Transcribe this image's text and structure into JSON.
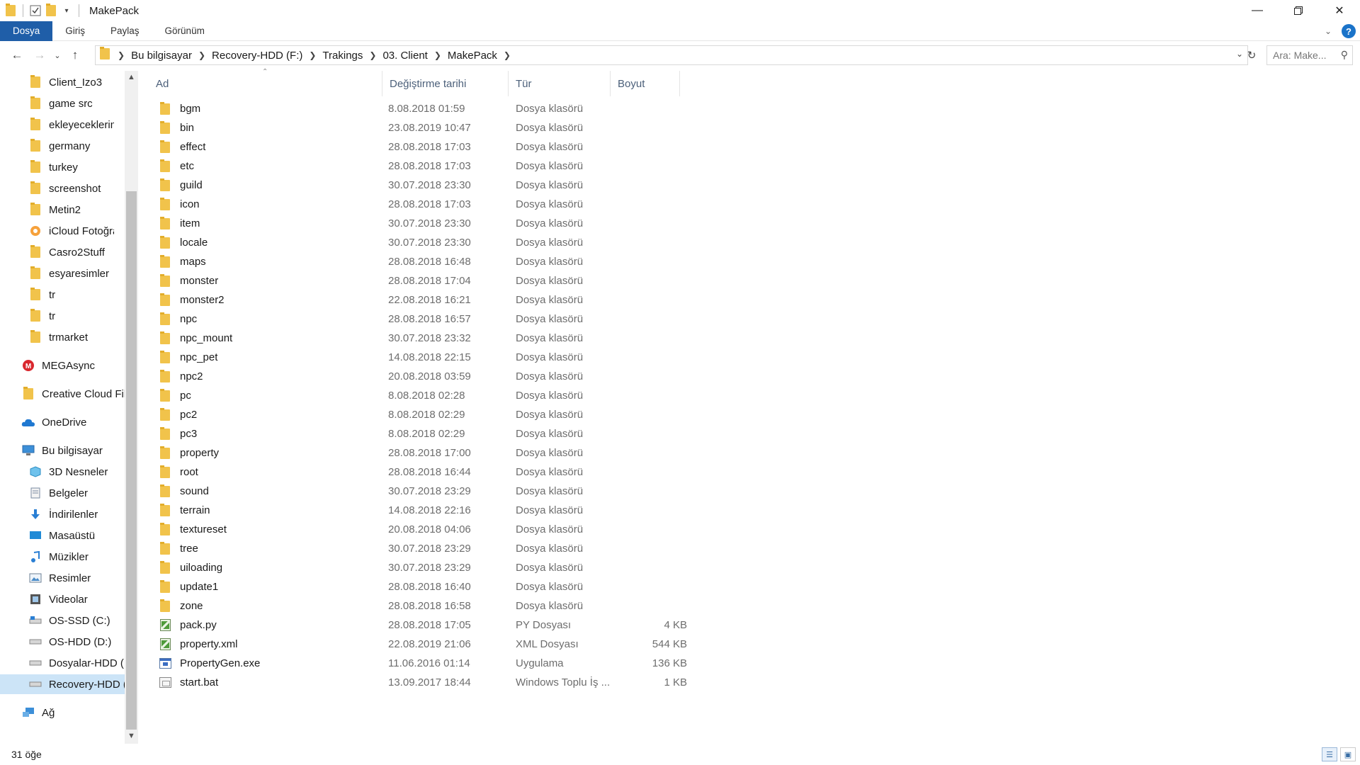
{
  "window": {
    "title": "MakePack"
  },
  "ribbon": {
    "tabs": [
      "Dosya",
      "Giriş",
      "Paylaş",
      "Görünüm"
    ]
  },
  "address": {
    "crumbs": [
      "Bu bilgisayar",
      "Recovery-HDD (F:)",
      "Trakings",
      "03. Client",
      "MakePack"
    ],
    "search_placeholder": "Ara: Make..."
  },
  "nav": {
    "quick_access": [
      {
        "label": "Client_Izo3",
        "pinned": true
      },
      {
        "label": "game src",
        "pinned": true
      },
      {
        "label": "ekleyeceklerim",
        "pinned": true
      },
      {
        "label": "germany",
        "pinned": true
      },
      {
        "label": "turkey",
        "pinned": true
      },
      {
        "label": "screenshot",
        "pinned": true
      },
      {
        "label": "Metin2",
        "pinned": true
      },
      {
        "label": "iCloud Fotoğrafları",
        "pinned": true
      },
      {
        "label": "Casro2Stuff",
        "pinned": true
      },
      {
        "label": "esyaresimler",
        "pinned": false
      },
      {
        "label": "tr",
        "pinned": false
      },
      {
        "label": "tr",
        "pinned": false
      },
      {
        "label": "trmarket",
        "pinned": false
      }
    ],
    "mega": "MEGAsync",
    "creative_cloud": "Creative Cloud Files",
    "onedrive": "OneDrive",
    "this_pc": "Bu bilgisayar",
    "pc_items": [
      "3D Nesneler",
      "Belgeler",
      "İndirilenler",
      "Masaüstü",
      "Müzikler",
      "Resimler",
      "Videolar",
      "OS-SSD (C:)",
      "OS-HDD (D:)",
      "Dosyalar-HDD (E:)",
      "Recovery-HDD (F:)"
    ],
    "network": "Ağ"
  },
  "columns": {
    "name": "Ad",
    "date": "Değiştirme tarihi",
    "type": "Tür",
    "size": "Boyut"
  },
  "files": [
    {
      "name": "bgm",
      "date": "8.08.2018 01:59",
      "type": "Dosya klasörü",
      "size": "",
      "kind": "folder"
    },
    {
      "name": "bin",
      "date": "23.08.2019 10:47",
      "type": "Dosya klasörü",
      "size": "",
      "kind": "folder"
    },
    {
      "name": "effect",
      "date": "28.08.2018 17:03",
      "type": "Dosya klasörü",
      "size": "",
      "kind": "folder"
    },
    {
      "name": "etc",
      "date": "28.08.2018 17:03",
      "type": "Dosya klasörü",
      "size": "",
      "kind": "folder"
    },
    {
      "name": "guild",
      "date": "30.07.2018 23:30",
      "type": "Dosya klasörü",
      "size": "",
      "kind": "folder"
    },
    {
      "name": "icon",
      "date": "28.08.2018 17:03",
      "type": "Dosya klasörü",
      "size": "",
      "kind": "folder"
    },
    {
      "name": "item",
      "date": "30.07.2018 23:30",
      "type": "Dosya klasörü",
      "size": "",
      "kind": "folder"
    },
    {
      "name": "locale",
      "date": "30.07.2018 23:30",
      "type": "Dosya klasörü",
      "size": "",
      "kind": "folder"
    },
    {
      "name": "maps",
      "date": "28.08.2018 16:48",
      "type": "Dosya klasörü",
      "size": "",
      "kind": "folder"
    },
    {
      "name": "monster",
      "date": "28.08.2018 17:04",
      "type": "Dosya klasörü",
      "size": "",
      "kind": "folder"
    },
    {
      "name": "monster2",
      "date": "22.08.2018 16:21",
      "type": "Dosya klasörü",
      "size": "",
      "kind": "folder"
    },
    {
      "name": "npc",
      "date": "28.08.2018 16:57",
      "type": "Dosya klasörü",
      "size": "",
      "kind": "folder"
    },
    {
      "name": "npc_mount",
      "date": "30.07.2018 23:32",
      "type": "Dosya klasörü",
      "size": "",
      "kind": "folder"
    },
    {
      "name": "npc_pet",
      "date": "14.08.2018 22:15",
      "type": "Dosya klasörü",
      "size": "",
      "kind": "folder"
    },
    {
      "name": "npc2",
      "date": "20.08.2018 03:59",
      "type": "Dosya klasörü",
      "size": "",
      "kind": "folder"
    },
    {
      "name": "pc",
      "date": "8.08.2018 02:28",
      "type": "Dosya klasörü",
      "size": "",
      "kind": "folder"
    },
    {
      "name": "pc2",
      "date": "8.08.2018 02:29",
      "type": "Dosya klasörü",
      "size": "",
      "kind": "folder"
    },
    {
      "name": "pc3",
      "date": "8.08.2018 02:29",
      "type": "Dosya klasörü",
      "size": "",
      "kind": "folder"
    },
    {
      "name": "property",
      "date": "28.08.2018 17:00",
      "type": "Dosya klasörü",
      "size": "",
      "kind": "folder"
    },
    {
      "name": "root",
      "date": "28.08.2018 16:44",
      "type": "Dosya klasörü",
      "size": "",
      "kind": "folder"
    },
    {
      "name": "sound",
      "date": "30.07.2018 23:29",
      "type": "Dosya klasörü",
      "size": "",
      "kind": "folder"
    },
    {
      "name": "terrain",
      "date": "14.08.2018 22:16",
      "type": "Dosya klasörü",
      "size": "",
      "kind": "folder"
    },
    {
      "name": "textureset",
      "date": "20.08.2018 04:06",
      "type": "Dosya klasörü",
      "size": "",
      "kind": "folder"
    },
    {
      "name": "tree",
      "date": "30.07.2018 23:29",
      "type": "Dosya klasörü",
      "size": "",
      "kind": "folder"
    },
    {
      "name": "uiloading",
      "date": "30.07.2018 23:29",
      "type": "Dosya klasörü",
      "size": "",
      "kind": "folder"
    },
    {
      "name": "update1",
      "date": "28.08.2018 16:40",
      "type": "Dosya klasörü",
      "size": "",
      "kind": "folder"
    },
    {
      "name": "zone",
      "date": "28.08.2018 16:58",
      "type": "Dosya klasörü",
      "size": "",
      "kind": "folder"
    },
    {
      "name": "pack.py",
      "date": "28.08.2018 17:05",
      "type": "PY Dosyası",
      "size": "4 KB",
      "kind": "script"
    },
    {
      "name": "property.xml",
      "date": "22.08.2019 21:06",
      "type": "XML Dosyası",
      "size": "544 KB",
      "kind": "script"
    },
    {
      "name": "PropertyGen.exe",
      "date": "11.06.2016 01:14",
      "type": "Uygulama",
      "size": "136 KB",
      "kind": "exe"
    },
    {
      "name": "start.bat",
      "date": "13.09.2017 18:44",
      "type": "Windows Toplu İş ...",
      "size": "1 KB",
      "kind": "bat"
    }
  ],
  "status": {
    "count_text": "31 öğe"
  },
  "colors": {
    "file_tab": "#1f5ea8",
    "folder": "#f1c34b",
    "selection": "#cce4f7"
  }
}
